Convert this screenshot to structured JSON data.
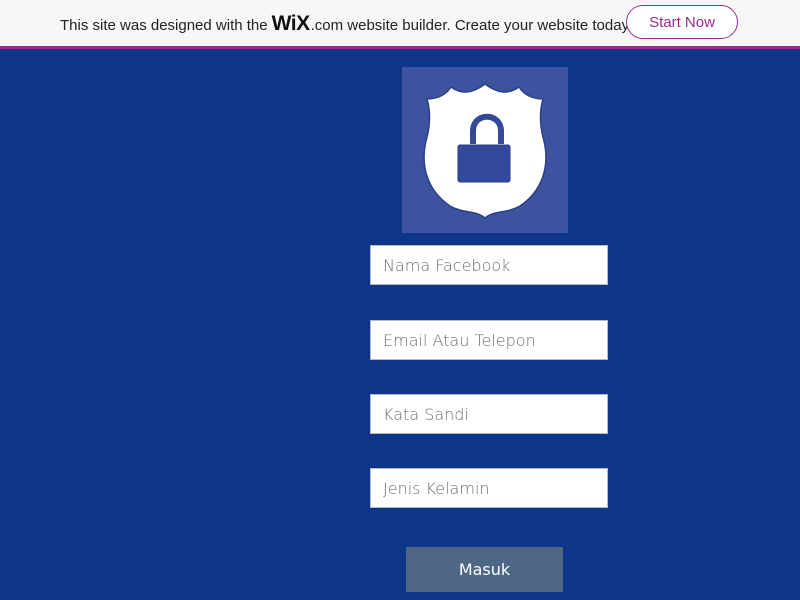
{
  "banner": {
    "text_before": "This site was designed with the",
    "logo": "WiX",
    "text_after": ".com website builder. Create your website today.",
    "button_label": "Start Now"
  },
  "form": {
    "name_placeholder": "Nama Facebook",
    "email_placeholder": "Email Atau Telepon",
    "password_placeholder": "Kata Sandi",
    "gender_placeholder": "Jenis Kelamin",
    "submit_label": "Masuk"
  },
  "colors": {
    "background": "#0d3689",
    "accent": "#9a2b8f",
    "shield_box": "#3d53a0",
    "button": "#4d6785"
  },
  "icons": {
    "shield": "shield-lock-icon"
  }
}
